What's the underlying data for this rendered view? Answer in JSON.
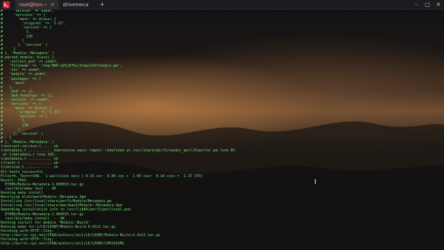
{
  "titlebar": {
    "tabs": [
      {
        "label": "root@ten:~",
        "active": true
      },
      {
        "label": "drivemeca",
        "active": false
      }
    ],
    "new_tab": "+",
    "controls": {
      "minimize": "–",
      "maximize": "□",
      "close": "✕"
    }
  },
  "colors": {
    "green": "#6ce077",
    "yellow": "#e8d870",
    "cyan": "#6fd7e0",
    "brand": "#d2202f"
  },
  "terminal": {
    "lines": [
      {
        "text": "#     'version' => undef,",
        "color": "green"
      },
      {
        "text": "#     'versions' => {",
        "color": "green"
      },
      {
        "text": "#       'main' => bless( {",
        "color": "green"
      },
      {
        "text": "#         'original' => '1.23',",
        "color": "green"
      },
      {
        "text": "#         'version' => [",
        "color": "green"
      },
      {
        "text": "#           1,",
        "color": "green"
      },
      {
        "text": "#           230",
        "color": "green"
      },
      {
        "text": "#         ]",
        "color": "green"
      },
      {
        "text": "#       }, 'version' )",
        "color": "green"
      },
      {
        "text": "#     }",
        "color": "green"
      },
      {
        "text": "# }, 'Module::Metadata' )",
        "color": "green"
      },
      {
        "text": "# parsed module: bless( {",
        "color": "green"
      },
      {
        "text": "#   'collect_pod' => undef,",
        "color": "green"
      },
      {
        "text": "#   'filename' => '/tmp/8W0-GZ5c870u/Simple53/Simple.pm',",
        "color": "green"
      },
      {
        "text": "#   'inc' => undef,",
        "color": "green"
      },
      {
        "text": "#   'module' => undef,",
        "color": "green"
      },
      {
        "text": "#   'packages' => [",
        "color": "green"
      },
      {
        "text": "#     'main'",
        "color": "green"
      },
      {
        "text": "#   ],",
        "color": "green"
      },
      {
        "text": "#   'pod' => {},",
        "color": "green"
      },
      {
        "text": "#   'pod_headings' => [],",
        "color": "green"
      },
      {
        "text": "#   'version' => undef,",
        "color": "green"
      },
      {
        "text": "#   'versions' => {",
        "color": "green"
      },
      {
        "text": "#     'main' => bless( {",
        "color": "green"
      },
      {
        "text": "#       'original' => '1.23',",
        "color": "green"
      },
      {
        "text": "#       'version' => [",
        "color": "green"
      },
      {
        "text": "#         1,",
        "color": "green"
      },
      {
        "text": "#         230",
        "color": "green"
      },
      {
        "text": "#       ]",
        "color": "green"
      },
      {
        "text": "#     }, 'version' )",
        "color": "green"
      },
      {
        "text": "#   }",
        "color": "green"
      },
      {
        "text": "# }, 'Module::Metadata' )",
        "color": "green"
      },
      {
        "text": "t/extract-version.t .... ok",
        "color": "green"
      },
      {
        "text": "t/metadata.t ........... Subroutine main::tmpdir redefined at /usr/share/perl5/vendor_perl/Exporter.pm line 66.",
        "color": "green"
      },
      {
        "text": " at t/metadata.t line 135.",
        "color": "green"
      },
      {
        "text": "t/metadata.t ........... ok",
        "color": "green"
      },
      {
        "text": "t/taint.t .............. ok",
        "color": "green"
      },
      {
        "text": "t/version.t ............ ok",
        "color": "green"
      },
      {
        "text": "All tests successful.",
        "color": "green"
      },
      {
        "text": "Files=9, Tests=348,  1 wallclock secs ( 0.15 usr  0.04 sys +  1.00 cusr  0.18 csys =  1.37 CPU)",
        "color": "green"
      },
      {
        "text": "Result: PASS",
        "color": "green"
      },
      {
        "text": "  ETHER/Module-Metadata-1.000033.tar.gz",
        "color": "green"
      },
      {
        "text": "  /usr/bin/make test -- OK",
        "color": "green"
      },
      {
        "text": "Running make install",
        "color": "green"
      },
      {
        "text": "Manifying blib/man3/Module::Metadata.3pm",
        "color": "green"
      },
      {
        "text": "Installing /usr/local/share/perl5/Module/Metadata.pm",
        "color": "green"
      },
      {
        "text": "Installing /usr/local/share/man/man3/Module::Metadata.3pm",
        "color": "green"
      },
      {
        "text": "Appending installation info to /usr/lib64/perl5/perllocal.pod",
        "color": "green"
      },
      {
        "text": "  ETHER/Module-Metadata-1.000033.tar.gz",
        "color": "green"
      },
      {
        "text": "  /usr/bin/make install  -- OK",
        "color": "green"
      },
      {
        "text": "Running install for module 'Module::Build'",
        "color": "green"
      },
      {
        "text": "Running make for L/LE/LEONT/Module-Build-0.4222.tar.gz",
        "color": "green"
      },
      {
        "text": "Fetching with HTTP::Tiny:",
        "color": "green"
      },
      {
        "text": "http://mirror.nyi.net/CPAN/authors/id/L/LE/LEONT/Module-Build-0.4222.tar.gz",
        "color": "green"
      },
      {
        "text": "Fetching with HTTP::Tiny:",
        "color": "green"
      },
      {
        "text": "http://mirror.nyi.net/CPAN/authors/id/L/LE/LEONT/CHECKSUMS",
        "color": "green"
      }
    ]
  }
}
